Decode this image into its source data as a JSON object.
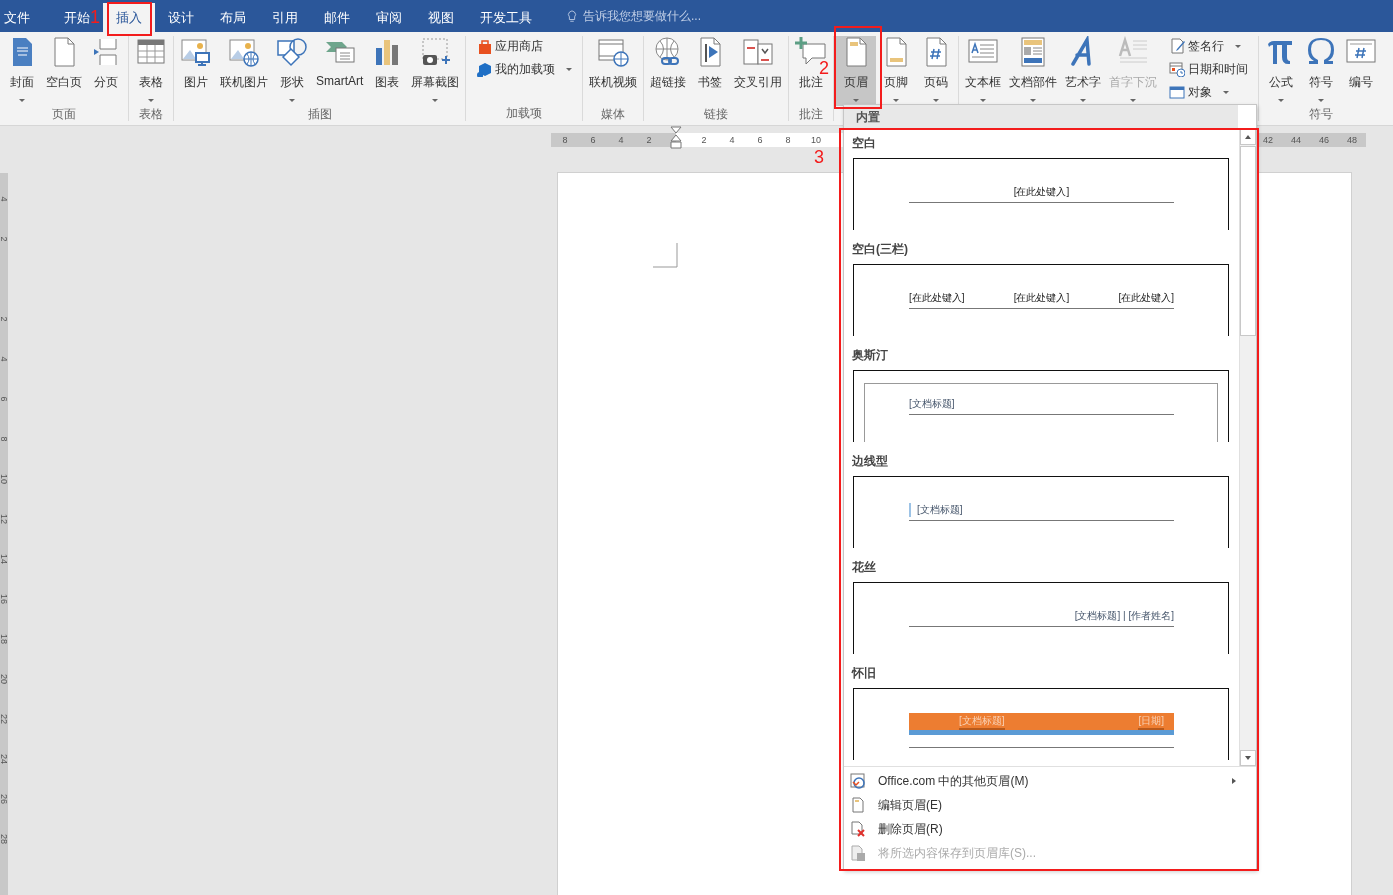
{
  "tabs": [
    {
      "label": "文件",
      "selected": false
    },
    {
      "label": "开始",
      "selected": false
    },
    {
      "label": "插入",
      "selected": true
    },
    {
      "label": "设计",
      "selected": false
    },
    {
      "label": "布局",
      "selected": false
    },
    {
      "label": "引用",
      "selected": false
    },
    {
      "label": "邮件",
      "selected": false
    },
    {
      "label": "审阅",
      "selected": false
    },
    {
      "label": "视图",
      "selected": false
    },
    {
      "label": "开发工具",
      "selected": false
    }
  ],
  "tell_me": {
    "placeholder": "告诉我您想要做什么..."
  },
  "ribbon": {
    "groups": [
      {
        "label": "页面",
        "items": [
          {
            "kind": "large",
            "label": "封面",
            "dropdown": true,
            "disabled": false,
            "pressed": false
          },
          {
            "kind": "large",
            "label": "空白页",
            "dropdown": false,
            "disabled": false,
            "pressed": false
          },
          {
            "kind": "large",
            "label": "分页",
            "dropdown": false,
            "disabled": false,
            "pressed": false
          }
        ]
      },
      {
        "label": "表格",
        "items": [
          {
            "kind": "large",
            "label": "表格",
            "dropdown": true,
            "disabled": false,
            "pressed": false
          }
        ]
      },
      {
        "label": "插图",
        "items": [
          {
            "kind": "large",
            "label": "图片",
            "dropdown": false,
            "disabled": false,
            "pressed": false
          },
          {
            "kind": "large",
            "label": "联机图片",
            "dropdown": false,
            "disabled": false,
            "pressed": false
          },
          {
            "kind": "large",
            "label": "形状",
            "dropdown": true,
            "disabled": false,
            "pressed": false
          },
          {
            "kind": "large",
            "label": "SmartArt",
            "dropdown": false,
            "disabled": false,
            "pressed": false
          },
          {
            "kind": "large",
            "label": "图表",
            "dropdown": false,
            "disabled": false,
            "pressed": false
          },
          {
            "kind": "large",
            "label": "屏幕截图",
            "dropdown": true,
            "disabled": false,
            "pressed": false
          }
        ]
      },
      {
        "label": "加载项",
        "items": [
          {
            "kind": "small",
            "label": "应用商店",
            "dropdown": false,
            "disabled": false,
            "pressed": false
          },
          {
            "kind": "small",
            "label": "我的加载项",
            "dropdown": true,
            "disabled": false,
            "pressed": false
          }
        ]
      },
      {
        "label": "媒体",
        "items": [
          {
            "kind": "large",
            "label": "联机视频",
            "dropdown": false,
            "disabled": false,
            "pressed": false
          }
        ]
      },
      {
        "label": "链接",
        "items": [
          {
            "kind": "large",
            "label": "超链接",
            "dropdown": false,
            "disabled": false,
            "pressed": false
          },
          {
            "kind": "large",
            "label": "书签",
            "dropdown": false,
            "disabled": false,
            "pressed": false
          },
          {
            "kind": "large",
            "label": "交叉引用",
            "dropdown": false,
            "disabled": false,
            "pressed": false
          }
        ]
      },
      {
        "label": "批注",
        "items": [
          {
            "kind": "large",
            "label": "批注",
            "dropdown": false,
            "disabled": false,
            "pressed": false
          }
        ]
      },
      {
        "items": [
          {
            "kind": "large",
            "label": "页眉",
            "dropdown": true,
            "disabled": false,
            "pressed": true
          },
          {
            "kind": "large",
            "label": "页脚",
            "dropdown": true,
            "disabled": false,
            "pressed": false
          },
          {
            "kind": "large",
            "label": "页码",
            "dropdown": true,
            "disabled": false,
            "pressed": false
          }
        ]
      },
      {
        "items": [
          {
            "kind": "large",
            "label": "文本框",
            "dropdown": true,
            "disabled": false,
            "pressed": false
          },
          {
            "kind": "large",
            "label": "文档部件",
            "dropdown": true,
            "disabled": false,
            "pressed": false
          },
          {
            "kind": "large",
            "label": "艺术字",
            "dropdown": true,
            "disabled": false,
            "pressed": false
          },
          {
            "kind": "large",
            "label": "首字下沉",
            "dropdown": true,
            "disabled": true,
            "pressed": false
          },
          {
            "kind": "small",
            "label": "签名行",
            "dropdown": true,
            "disabled": false,
            "pressed": false
          },
          {
            "kind": "small",
            "label": "日期和时间",
            "dropdown": false,
            "disabled": false,
            "pressed": false
          },
          {
            "kind": "small",
            "label": "对象",
            "dropdown": true,
            "disabled": false,
            "pressed": false
          }
        ]
      },
      {
        "label": "符号",
        "items": [
          {
            "kind": "large",
            "label": "公式",
            "dropdown": true,
            "disabled": false,
            "pressed": false
          },
          {
            "kind": "large",
            "label": "符号",
            "dropdown": true,
            "disabled": false,
            "pressed": false
          },
          {
            "kind": "large",
            "label": "编号",
            "dropdown": false,
            "disabled": false,
            "pressed": false
          }
        ]
      }
    ]
  },
  "ruler": {
    "left_labels": [
      "8",
      "6",
      "4",
      "2"
    ],
    "right_labels": [
      "2",
      "4",
      "6",
      "8",
      "10"
    ],
    "far_labels": [
      "42",
      "44",
      "46",
      "48"
    ]
  },
  "vertical_ruler": {
    "labels": [
      "4",
      "2",
      "2",
      "4",
      "6",
      "8",
      "10",
      "12",
      "14",
      "16",
      "18",
      "20",
      "22",
      "24",
      "26",
      "28"
    ]
  },
  "header_gallery": {
    "section_label": "内置",
    "items": [
      {
        "title": "空白",
        "kind": "blank",
        "texts": [
          "[在此处键入]"
        ]
      },
      {
        "title": "空白(三栏)",
        "kind": "three_column",
        "texts": [
          "[在此处键入]",
          "[在此处键入]",
          "[在此处键入]"
        ]
      },
      {
        "title": "奥斯汀",
        "kind": "austin",
        "texts": [
          "[文档标题]"
        ]
      },
      {
        "title": "边线型",
        "kind": "sideline",
        "texts": [
          "[文档标题]"
        ]
      },
      {
        "title": "花丝",
        "kind": "filigree",
        "texts": [
          "[文档标题] | [作者姓名]"
        ]
      },
      {
        "title": "怀旧",
        "kind": "retro",
        "texts": [
          "[文档标题]",
          "[日期]"
        ]
      }
    ],
    "menu": [
      {
        "label": "Office.com 中的其他页眉(M)",
        "submenu": true,
        "disabled": false
      },
      {
        "label": "编辑页眉(E)",
        "submenu": false,
        "disabled": false
      },
      {
        "label": "删除页眉(R)",
        "submenu": false,
        "disabled": false
      },
      {
        "label": "将所选内容保存到页眉库(S)...",
        "submenu": false,
        "disabled": true
      }
    ]
  },
  "annotations": [
    {
      "label": "1"
    },
    {
      "label": "2"
    },
    {
      "label": "3"
    }
  ]
}
